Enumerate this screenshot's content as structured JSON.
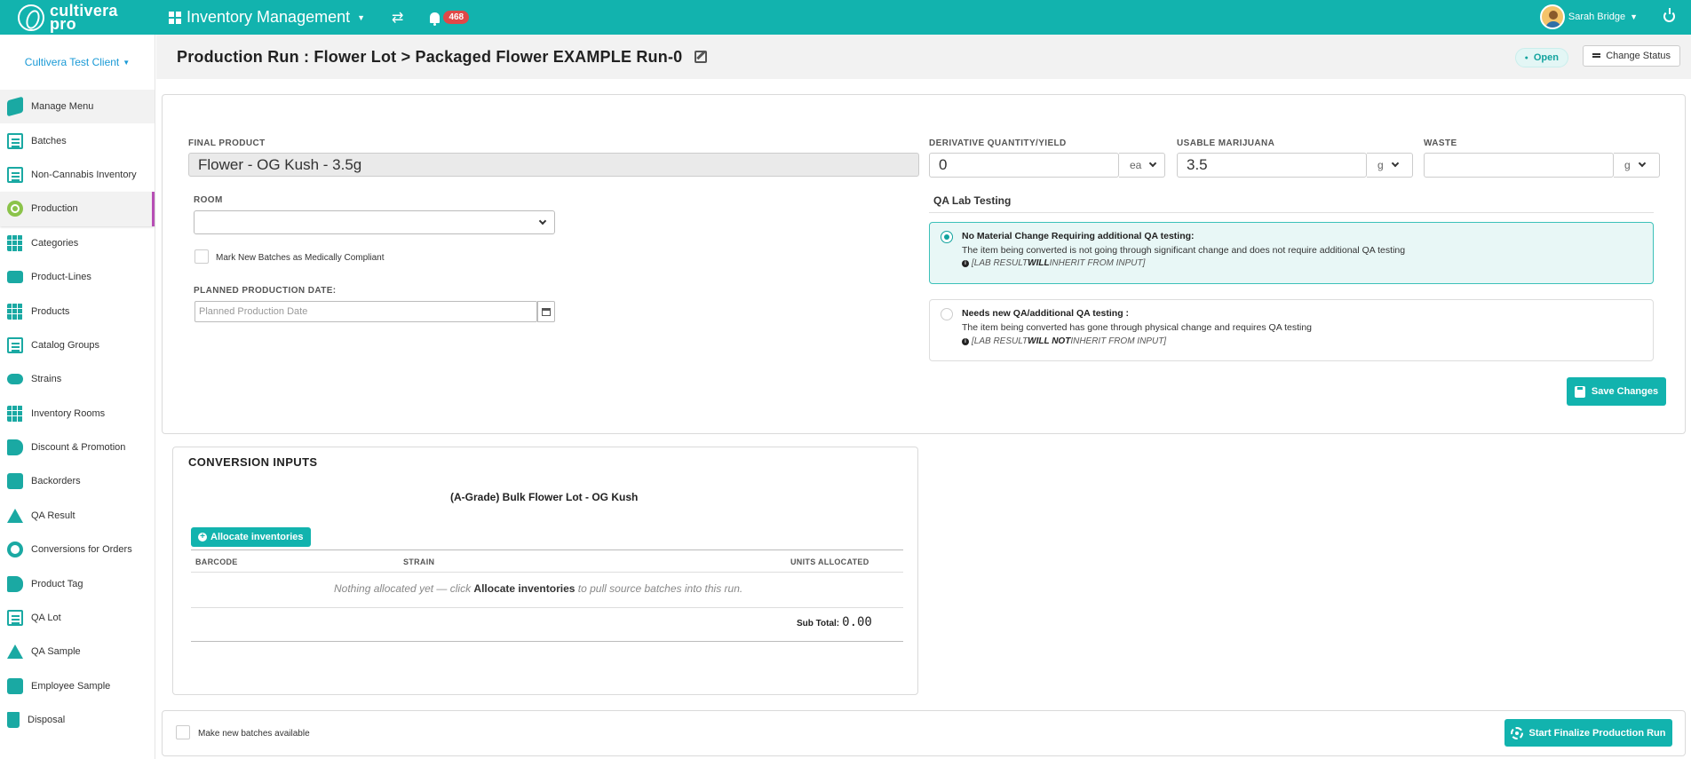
{
  "app": {
    "logo_line1": "cultivera",
    "logo_line2": "pro",
    "module": "Inventory Management",
    "notification_count": "468",
    "user_name": "Sarah Bridge"
  },
  "sidebar": {
    "client": "Cultivera Test Client",
    "items": [
      {
        "label": "Manage Menu"
      },
      {
        "label": "Batches"
      },
      {
        "label": "Non-Cannabis Inventory"
      },
      {
        "label": "Production"
      },
      {
        "label": "Categories"
      },
      {
        "label": "Product-Lines"
      },
      {
        "label": "Products"
      },
      {
        "label": "Catalog Groups"
      },
      {
        "label": "Strains"
      },
      {
        "label": "Inventory Rooms"
      },
      {
        "label": "Discount & Promotion"
      },
      {
        "label": "Backorders"
      },
      {
        "label": "QA Result"
      },
      {
        "label": "Conversions for Orders"
      },
      {
        "label": "Product Tag"
      },
      {
        "label": "QA Lot"
      },
      {
        "label": "QA Sample"
      },
      {
        "label": "Employee Sample"
      },
      {
        "label": "Disposal"
      }
    ]
  },
  "header": {
    "title": "Production Run : Flower Lot > Packaged Flower EXAMPLE Run-0",
    "status": "Open",
    "change_status": "Change Status"
  },
  "form": {
    "final_product_label": "FINAL PRODUCT",
    "final_product_value": "Flower - OG Kush  - 3.5g",
    "room_label": "ROOM",
    "room_value": "",
    "medical_label": "Mark New Batches as Medically Compliant",
    "planned_date_label": "PLANNED PRODUCTION DATE:",
    "planned_date_placeholder": "Planned Production Date",
    "derivative_label": "DERIVATIVE QUANTITY/YIELD",
    "derivative_value": "0",
    "derivative_unit": "ea",
    "usable_label": "USABLE MARIJUANA",
    "usable_value": "3.5",
    "usable_unit": "g",
    "waste_label": "WASTE",
    "waste_value": "",
    "waste_unit": "g",
    "qa_title": "QA Lab Testing",
    "qa_option1_head": "No Material Change Requiring additional QA testing:",
    "qa_option1_desc": "The item being converted is not going through significant change and does not require additional QA testing",
    "qa_option1_note_a": "[LAB RESULT ",
    "qa_option1_note_b": "WILL",
    "qa_option1_note_c": " INHERIT FROM INPUT]",
    "qa_option2_head": "Needs new QA/additional QA testing :",
    "qa_option2_desc": "The item being converted has gone through physical change and requires QA testing",
    "qa_option2_note_a": "[LAB RESULT ",
    "qa_option2_note_b": "WILL NOT",
    "qa_option2_note_c": " INHERIT FROM INPUT]",
    "save_label": "Save Changes"
  },
  "conversion": {
    "title": "CONVERSION INPUTS",
    "input_name": "(A-Grade) Bulk Flower Lot - OG Kush",
    "allocate_label": "Allocate inventories",
    "columns": [
      "BARCODE",
      "STRAIN",
      "UNITS ALLOCATED"
    ],
    "empty_a": "Nothing allocated yet — click ",
    "empty_b": "Allocate inventories",
    "empty_c": " to pull source batches into this run.",
    "subtotal_label": "Sub Total:",
    "subtotal_value": "0.00"
  },
  "footer": {
    "make_available_label": "Make new batches available",
    "finalize_label": "Start Finalize Production Run"
  }
}
